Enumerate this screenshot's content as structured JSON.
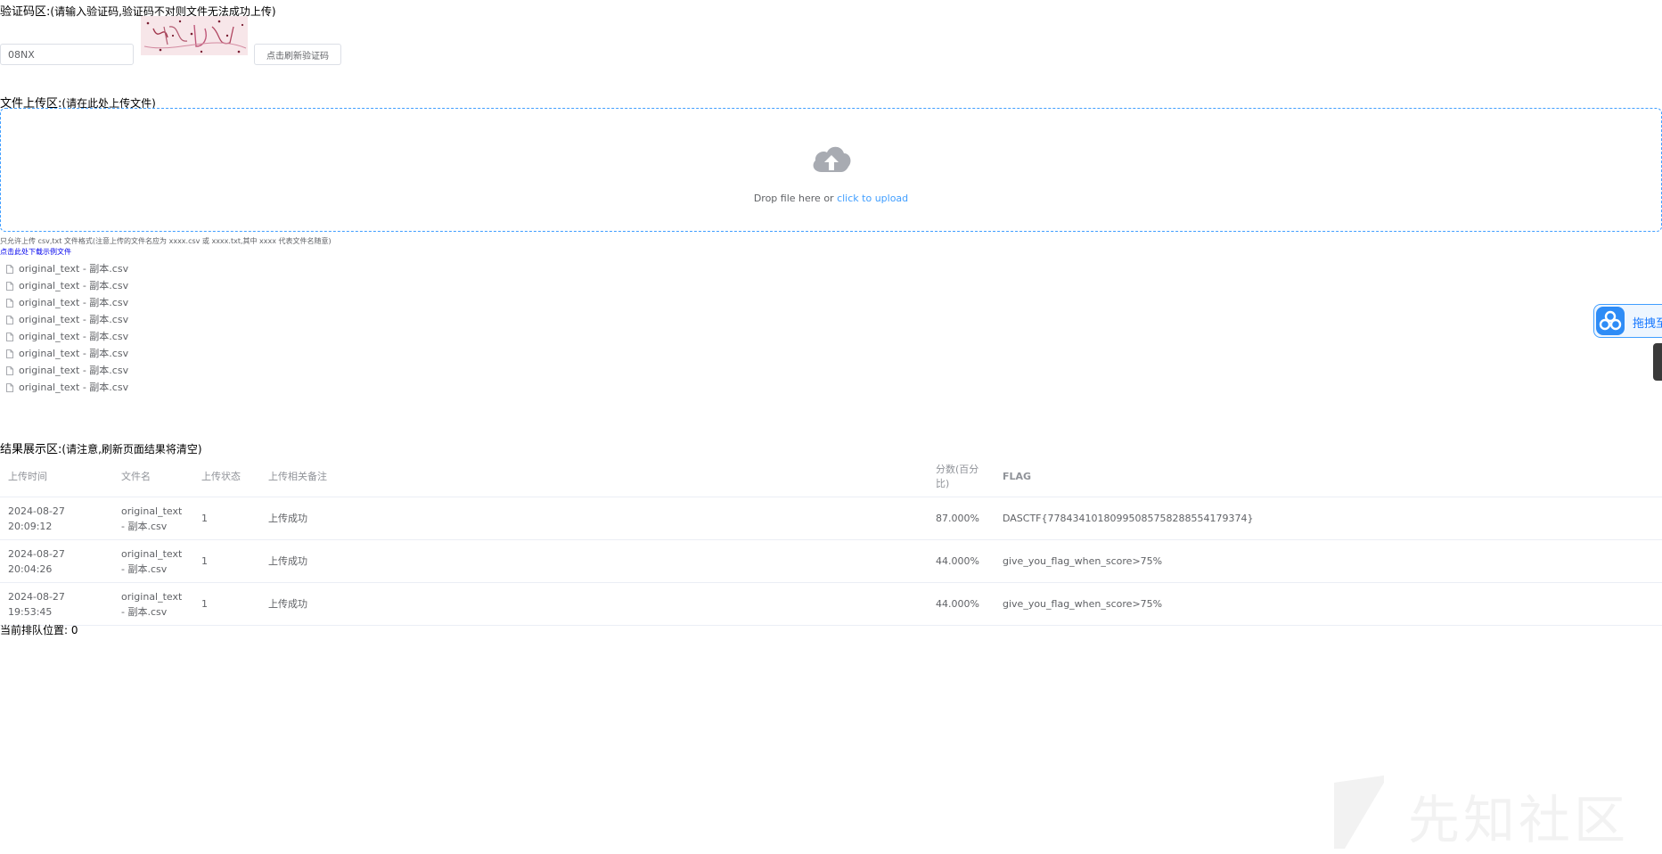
{
  "captcha": {
    "title": "验证码区:",
    "hint": "(请输入验证码,验证码不对则文件无法成功上传)",
    "value": "08NX",
    "refresh_label": "点击刷新验证码"
  },
  "upload": {
    "title": "文件上传区:",
    "hint": "(请在此处上传文件)",
    "drop_text": "Drop file here or ",
    "click_text": "click to upload",
    "tip": "只允许上传 csv,txt 文件格式(注意上传的文件名应为 xxxx.csv 或 xxxx.txt,其中 xxxx 代表文件名随意)",
    "sample_link": "点击此处下载示例文件",
    "files": [
      "original_text - 副本.csv",
      "original_text - 副本.csv",
      "original_text - 副本.csv",
      "original_text - 副本.csv",
      "original_text - 副本.csv",
      "original_text - 副本.csv",
      "original_text - 副本.csv",
      "original_text - 副本.csv"
    ]
  },
  "results": {
    "title": "结果展示区:",
    "hint": "(请注意,刷新页面结果将清空)",
    "headers": [
      "上传时间",
      "文件名",
      "上传状态",
      "上传相关备注",
      "分数(百分比)",
      "FLAG"
    ],
    "rows": [
      [
        "2024-08-27 20:09:12",
        "original_text - 副本.csv",
        "1",
        "上传成功",
        "87.000%",
        "DASCTF{77843410180995085758288554179374}"
      ],
      [
        "2024-08-27 20:04:26",
        "original_text - 副本.csv",
        "1",
        "上传成功",
        "44.000%",
        "give_you_flag_when_score>75%"
      ],
      [
        "2024-08-27 19:53:45",
        "original_text - 副本.csv",
        "1",
        "上传成功",
        "44.000%",
        "give_you_flag_when_score>75%"
      ]
    ]
  },
  "queue": {
    "label": "当前排队位置: ",
    "value": "0"
  },
  "float_button": {
    "label": "拖拽至"
  },
  "watermark": {
    "text": "先知社区"
  },
  "colors": {
    "accent": "#409eff",
    "text": "#606266",
    "header": "#909399"
  }
}
